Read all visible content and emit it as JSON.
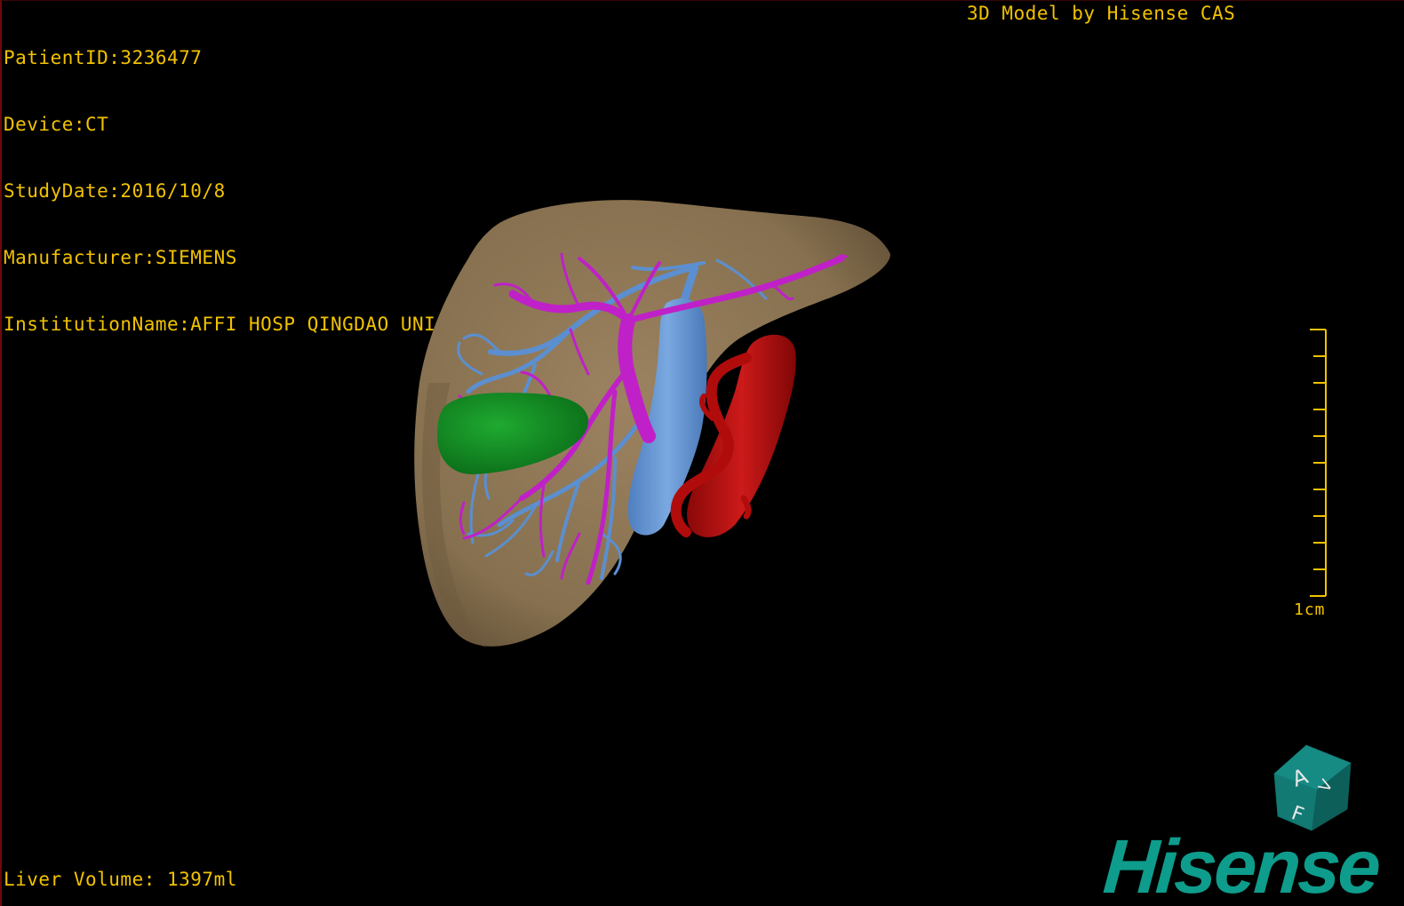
{
  "header": {
    "patient_id": "PatientID:3236477",
    "device": "Device:CT",
    "study_date": "StudyDate:2016/10/8",
    "manufacturer": "Manufacturer:SIEMENS",
    "institution": "InstitutionName:AFFI HOSP QINGDAO UNI"
  },
  "vendor_caption": "3D Model by Hisense CAS",
  "footer": {
    "liver_volume": "Liver Volume: 1397ml"
  },
  "scale_bar": {
    "label": "1cm",
    "tick_count": 11
  },
  "orientation_cube": {
    "letters": [
      "A",
      "F",
      "V"
    ]
  },
  "brand": {
    "logo_text": "Hisense"
  },
  "colors": {
    "overlay_text": "#f2c200",
    "background": "#000000",
    "liver": "#8a7250",
    "portal_vein": "#c020c8",
    "hepatic_vein": "#5b8fd0",
    "artery": "#b00c0c",
    "tumor": "#138a22",
    "brand": "#0e9c8c"
  },
  "model": {
    "structures": [
      "liver-surface",
      "hepatic-vein",
      "portal-vein",
      "artery",
      "tumor"
    ]
  }
}
